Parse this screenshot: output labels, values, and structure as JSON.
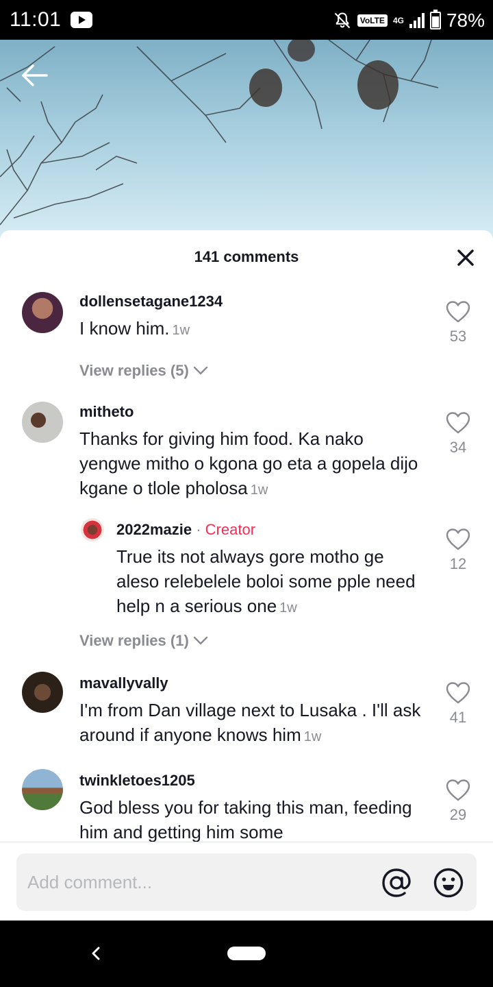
{
  "status_bar": {
    "time": "11:01",
    "network_badge": "VoLTE",
    "network_type": "4G",
    "battery": "78%",
    "icons": [
      "youtube-icon",
      "bell-off-icon",
      "signal-icon",
      "battery-icon"
    ]
  },
  "sheet": {
    "title": "141 comments"
  },
  "comments": [
    {
      "username": "dollensetagane1234",
      "text": "I know him.",
      "time": "1w",
      "likes": "53",
      "view_replies": "View replies (5)"
    },
    {
      "username": "mitheto",
      "text": "Thanks for giving him food. Ka nako yengwe mitho o kgona go eta a gopela dijo kgane o tlole pholosa",
      "time": "1w",
      "likes": "34",
      "reply": {
        "username": "2022mazie",
        "separator": "·",
        "tag": "Creator",
        "text": "True its not always gore motho ge aleso relebelele boloi some pple need help n a serious one",
        "time": "1w",
        "likes": "12"
      },
      "view_replies": "View replies (1)"
    },
    {
      "username": "mavallyvally",
      "text": "I'm from Dan village next to Lusaka . I'll ask around if anyone knows him",
      "time": "1w",
      "likes": "41"
    },
    {
      "username": "twinkletoes1205",
      "text": "God bless you for taking this man, feeding him and getting him some",
      "likes": "29"
    }
  ],
  "input": {
    "placeholder": "Add comment..."
  },
  "colors": {
    "creator_tag": "#fe2c55",
    "muted_text": "#8a8b91",
    "primary_text": "#161823"
  }
}
